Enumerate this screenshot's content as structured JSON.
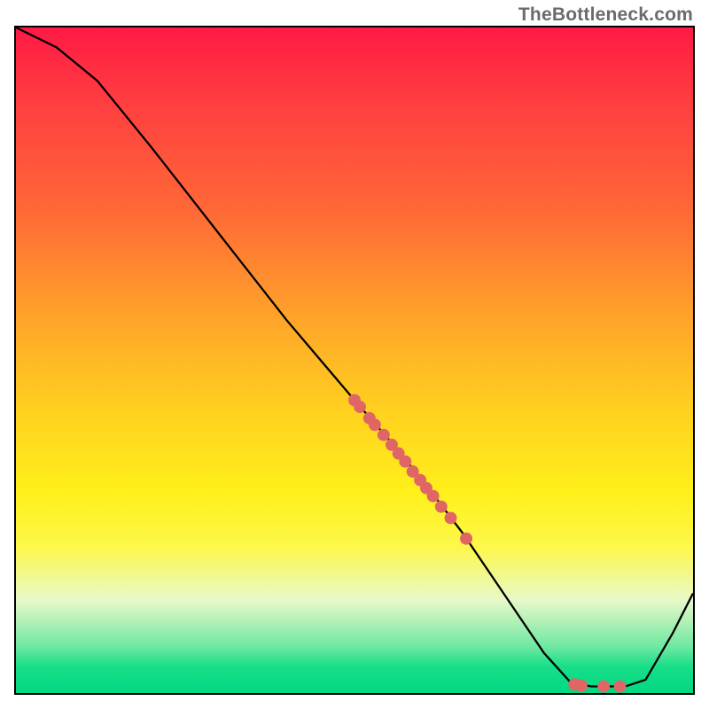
{
  "watermark": "TheBottleneck.com",
  "chart_data": {
    "type": "line",
    "title": "",
    "xlabel": "",
    "ylabel": "",
    "xlim": [
      0,
      100
    ],
    "ylim": [
      0,
      100
    ],
    "curve": {
      "name": "bottleneck-curve",
      "points": [
        {
          "x": 0,
          "y": 100
        },
        {
          "x": 6,
          "y": 97
        },
        {
          "x": 12,
          "y": 92
        },
        {
          "x": 20,
          "y": 82
        },
        {
          "x": 30,
          "y": 69
        },
        {
          "x": 40,
          "y": 56
        },
        {
          "x": 50,
          "y": 44
        },
        {
          "x": 56,
          "y": 37
        },
        {
          "x": 60,
          "y": 32
        },
        {
          "x": 66,
          "y": 24
        },
        {
          "x": 72,
          "y": 15
        },
        {
          "x": 78,
          "y": 6
        },
        {
          "x": 82,
          "y": 1.5
        },
        {
          "x": 85,
          "y": 1
        },
        {
          "x": 90,
          "y": 1
        },
        {
          "x": 93,
          "y": 2
        },
        {
          "x": 97,
          "y": 9
        },
        {
          "x": 100,
          "y": 15
        }
      ]
    },
    "scatter": {
      "name": "sample-points",
      "color": "#e06666",
      "points": [
        {
          "x": 50.0,
          "y": 44.0
        },
        {
          "x": 50.8,
          "y": 43.0
        },
        {
          "x": 52.2,
          "y": 41.3
        },
        {
          "x": 53.0,
          "y": 40.3
        },
        {
          "x": 54.3,
          "y": 38.8
        },
        {
          "x": 55.5,
          "y": 37.3
        },
        {
          "x": 56.5,
          "y": 36.0
        },
        {
          "x": 57.5,
          "y": 34.8
        },
        {
          "x": 58.6,
          "y": 33.3
        },
        {
          "x": 59.7,
          "y": 32.0
        },
        {
          "x": 60.6,
          "y": 30.8
        },
        {
          "x": 61.6,
          "y": 29.6
        },
        {
          "x": 62.8,
          "y": 28.0
        },
        {
          "x": 64.2,
          "y": 26.3
        },
        {
          "x": 66.5,
          "y": 23.2
        },
        {
          "x": 82.5,
          "y": 1.3
        },
        {
          "x": 83.5,
          "y": 1.1
        },
        {
          "x": 86.8,
          "y": 1.0
        },
        {
          "x": 89.2,
          "y": 1.0
        }
      ]
    },
    "gradient_stops": [
      {
        "pos": 0,
        "color": "#ff1a44"
      },
      {
        "pos": 12,
        "color": "#ff4040"
      },
      {
        "pos": 28,
        "color": "#ff6a36"
      },
      {
        "pos": 44,
        "color": "#ffa529"
      },
      {
        "pos": 58,
        "color": "#ffd21f"
      },
      {
        "pos": 70,
        "color": "#fff01a"
      },
      {
        "pos": 78,
        "color": "#fdf84a"
      },
      {
        "pos": 86,
        "color": "#e8f9c8"
      },
      {
        "pos": 93,
        "color": "#6fe8a3"
      },
      {
        "pos": 96,
        "color": "#18df88"
      },
      {
        "pos": 100,
        "color": "#00d884"
      }
    ]
  }
}
